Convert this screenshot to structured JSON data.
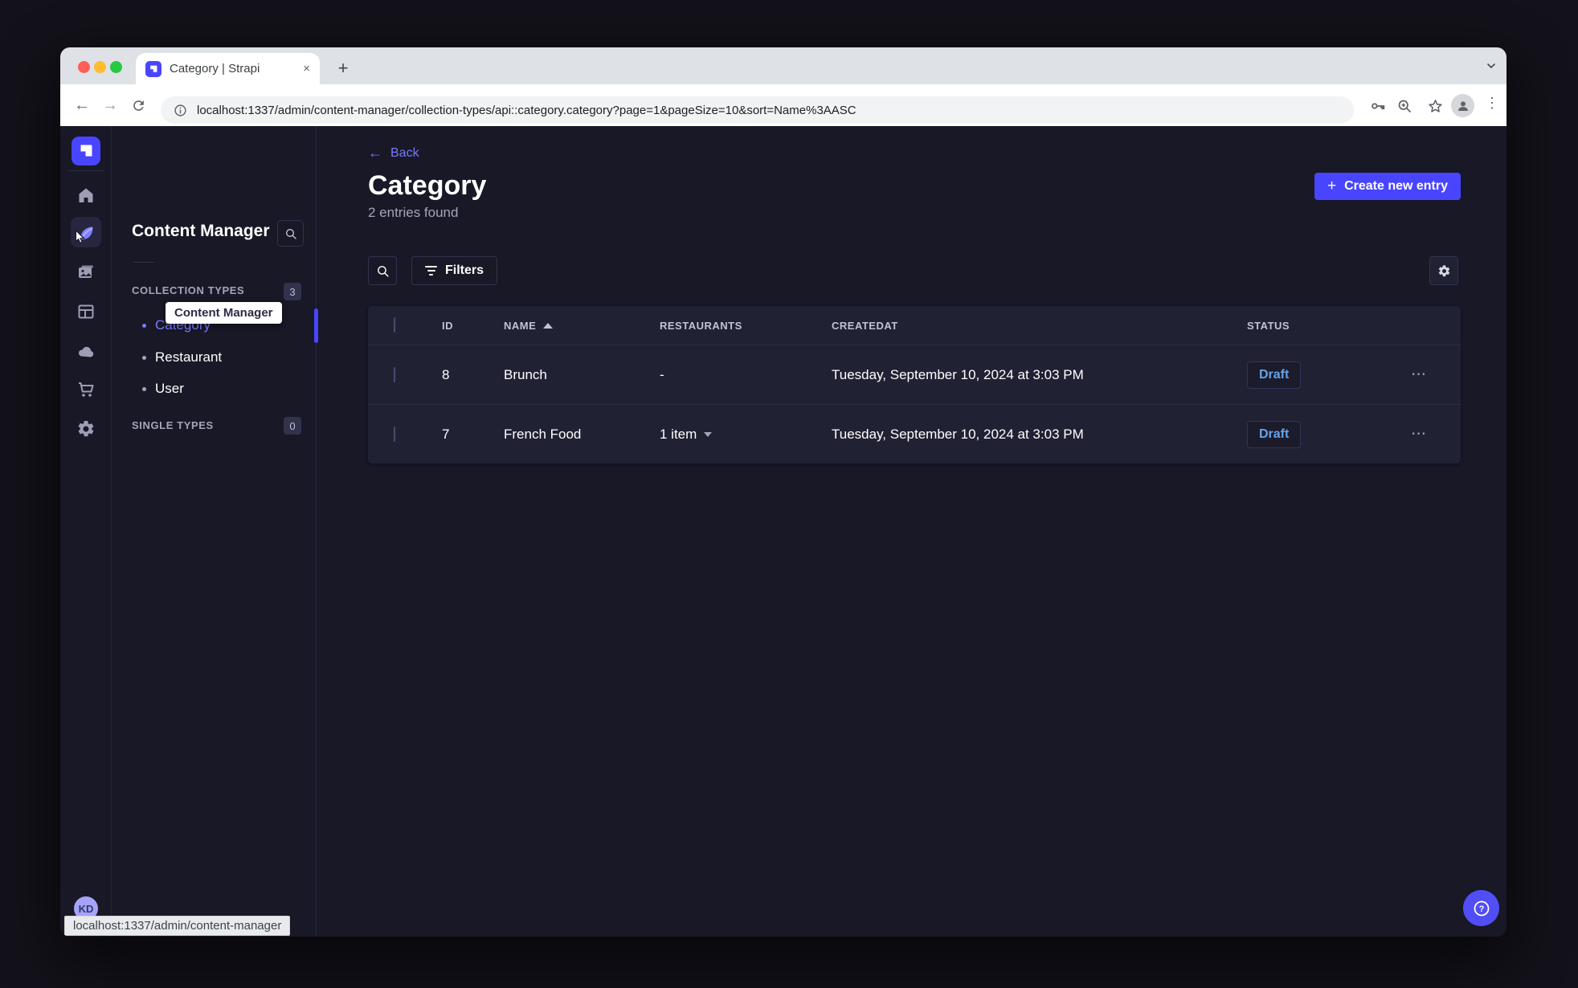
{
  "browser": {
    "tab_title": "Category | Strapi",
    "close_glyph": "×",
    "new_tab_glyph": "+",
    "back_glyph": "←",
    "forward_glyph": "→",
    "menu_glyph": "⋮",
    "url": "localhost:1337/admin/content-manager/collection-types/api::category.category?page=1&pageSize=10&sort=Name%3AASC"
  },
  "statusbar": {
    "url": "localhost:1337/admin/content-manager"
  },
  "rail": {
    "tooltip": "Content Manager",
    "avatar_initials": "KD"
  },
  "subnav": {
    "title": "Content Manager",
    "sections": [
      {
        "label": "COLLECTION TYPES",
        "count": "3"
      },
      {
        "label": "SINGLE TYPES",
        "count": "0"
      }
    ],
    "items": [
      {
        "label": "Category",
        "selected": true
      },
      {
        "label": "Restaurant",
        "selected": false
      },
      {
        "label": "User",
        "selected": false
      }
    ]
  },
  "main": {
    "back_label": "Back",
    "back_glyph": "←",
    "title": "Category",
    "subtitle": "2 entries found",
    "create_plus": "+",
    "create_button": "Create new entry",
    "filters_button": "Filters",
    "table": {
      "headers": {
        "id": "ID",
        "name": "NAME",
        "restaurants": "RESTAURANTS",
        "createdat": "CREATEDAT",
        "status": "STATUS"
      },
      "rows": [
        {
          "id": "8",
          "name": "Brunch",
          "restaurants": "-",
          "created": "Tuesday, September 10, 2024 at 3:03 PM",
          "status": "Draft"
        },
        {
          "id": "7",
          "name": "French Food",
          "restaurants": "1 item",
          "created": "Tuesday, September 10, 2024 at 3:03 PM",
          "status": "Draft"
        }
      ],
      "actions_glyph": "⋯"
    }
  },
  "colors": {
    "primary": "#4945FF",
    "link": "#7B79FF",
    "draft_text": "#66A3E8",
    "surface": "#212134",
    "background": "#181826"
  }
}
